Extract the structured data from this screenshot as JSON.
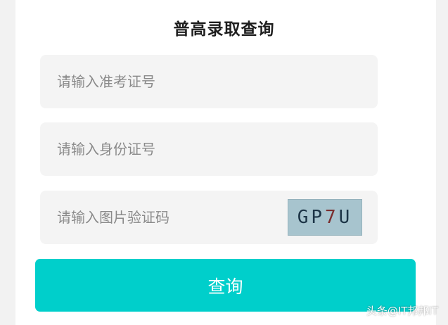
{
  "page": {
    "title": "普高录取查询"
  },
  "form": {
    "admission_number_placeholder": "请输入准考证号",
    "id_number_placeholder": "请输入身份证号",
    "captcha_placeholder": "请输入图片验证码",
    "captcha_text": [
      "G",
      "P",
      "7",
      "U"
    ],
    "submit_label": "查询"
  },
  "watermark": "头条@IT邦邦IT",
  "colors": {
    "accent": "#00cfcb",
    "field_bg": "#f4f4f4",
    "captcha_bg": "#a7c4ce"
  }
}
